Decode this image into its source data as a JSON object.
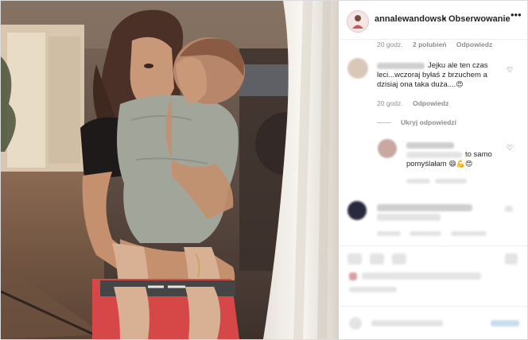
{
  "post": {
    "username": "annalewandowsk",
    "separator": "•",
    "follow_label": "Obserwowanie",
    "more_icon": "more-horizontal-icon"
  },
  "comments": [
    {
      "meta": {
        "time": "20 godz.",
        "likes": "2 polubień",
        "reply": "Odpowiedz"
      }
    },
    {
      "text_lines": [
        "Jejku ale ten czas",
        "leci...wczoraj byłaś z brzuchem a",
        "dzisiaj ona taka duża...."
      ],
      "emoji": "😍",
      "meta": {
        "time": "20 godz.",
        "reply": "Odpowiedz"
      }
    }
  ],
  "hide_replies_label": "Ukryj odpowiedzi",
  "reply": {
    "text_lines": [
      "to samo",
      "pomyślałam"
    ],
    "emojis": "😄💪😍"
  },
  "colors": {
    "text": "#262626",
    "meta": "#8e8e8e",
    "border": "#dbdbdb"
  }
}
